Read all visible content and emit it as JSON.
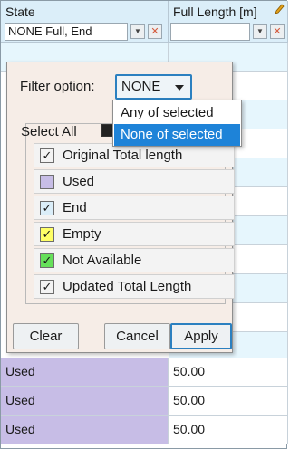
{
  "columns": {
    "state": {
      "title": "State",
      "filter_value": "NONE Full, End"
    },
    "full_length": {
      "title": "Full Length [m]"
    }
  },
  "rows": [
    {
      "state": "Used",
      "full_length": "50.00"
    },
    {
      "state": "Used",
      "full_length": "50.00"
    },
    {
      "state": "Used",
      "full_length": "50.00"
    }
  ],
  "filter_popup": {
    "filter_option_label": "Filter option:",
    "filter_option_value": "NONE",
    "select_all_label": "Select All",
    "items": [
      {
        "label": "Original Total length",
        "checked": true,
        "color": "#f3f3f3"
      },
      {
        "label": "Used",
        "checked": false,
        "color": "#c7bde6"
      },
      {
        "label": "End",
        "checked": true,
        "color": "#dbeef9"
      },
      {
        "label": "Empty",
        "checked": true,
        "color": "#ffff66"
      },
      {
        "label": "Not Available",
        "checked": true,
        "color": "#66e05a"
      },
      {
        "label": "Updated Total Length",
        "checked": true,
        "color": "#f3f3f3"
      }
    ],
    "buttons": {
      "clear": "Clear",
      "cancel": "Cancel",
      "apply": "Apply"
    }
  },
  "filter_option_menu": {
    "options": [
      "Any of selected",
      "None of selected"
    ],
    "highlighted": "None of selected"
  },
  "colors": {
    "header_bg": "#dbeef9",
    "popup_bg": "#f6ede7",
    "accent": "#1e83d8",
    "used_row": "#c7bde6"
  },
  "icons": {
    "dropdown": "chevron-down-icon",
    "clear_filter": "clear-filter-icon",
    "edit": "pencil-icon",
    "check": "check-icon"
  }
}
